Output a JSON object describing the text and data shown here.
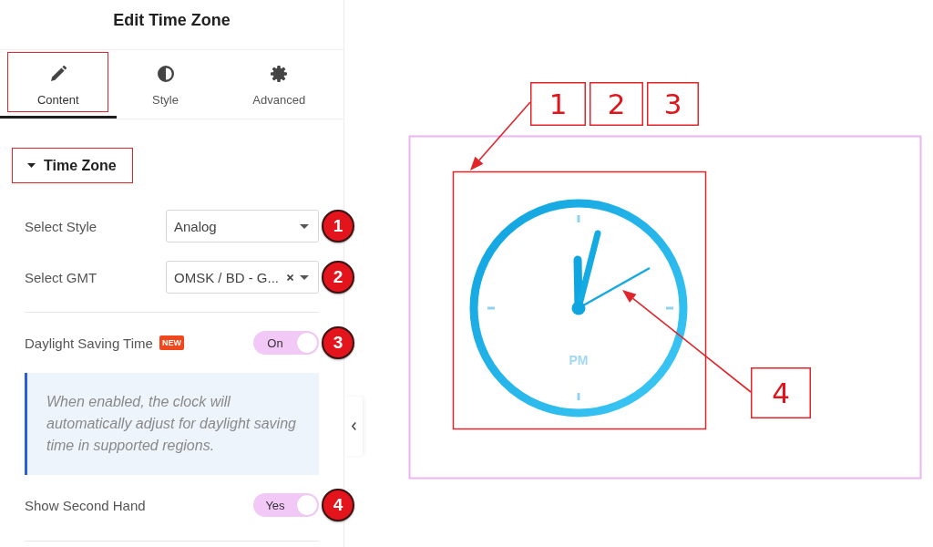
{
  "panel": {
    "title": "Edit Time Zone",
    "tabs": [
      {
        "label": "Content",
        "selected": true,
        "highlighted": true
      },
      {
        "label": "Style",
        "selected": false,
        "highlighted": false
      },
      {
        "label": "Advanced",
        "selected": false,
        "highlighted": false
      }
    ],
    "section": {
      "title": "Time Zone",
      "expanded": true,
      "highlighted": true
    },
    "controls": [
      {
        "kind": "select",
        "label": "Select Style",
        "value": "Analog",
        "clearable": false,
        "marker": "1"
      },
      {
        "kind": "select",
        "label": "Select GMT",
        "value": "OMSK / BD - G...",
        "clearable": true,
        "marker": "2"
      },
      {
        "kind": "toggle",
        "label": "Daylight Saving Time",
        "badge": "NEW",
        "on": true,
        "toggle_text": "On",
        "marker": "3"
      },
      {
        "kind": "note",
        "text": "When enabled, the clock will automatically adjust for daylight saving time in supported regions."
      },
      {
        "kind": "toggle",
        "label": "Show Second Hand",
        "on": true,
        "toggle_text": "Yes",
        "marker": "4"
      }
    ]
  },
  "preview": {
    "clock": {
      "meridiem": "PM"
    },
    "callouts": [
      {
        "label": "1"
      },
      {
        "label": "2"
      },
      {
        "label": "3"
      },
      {
        "label": "4"
      }
    ]
  }
}
